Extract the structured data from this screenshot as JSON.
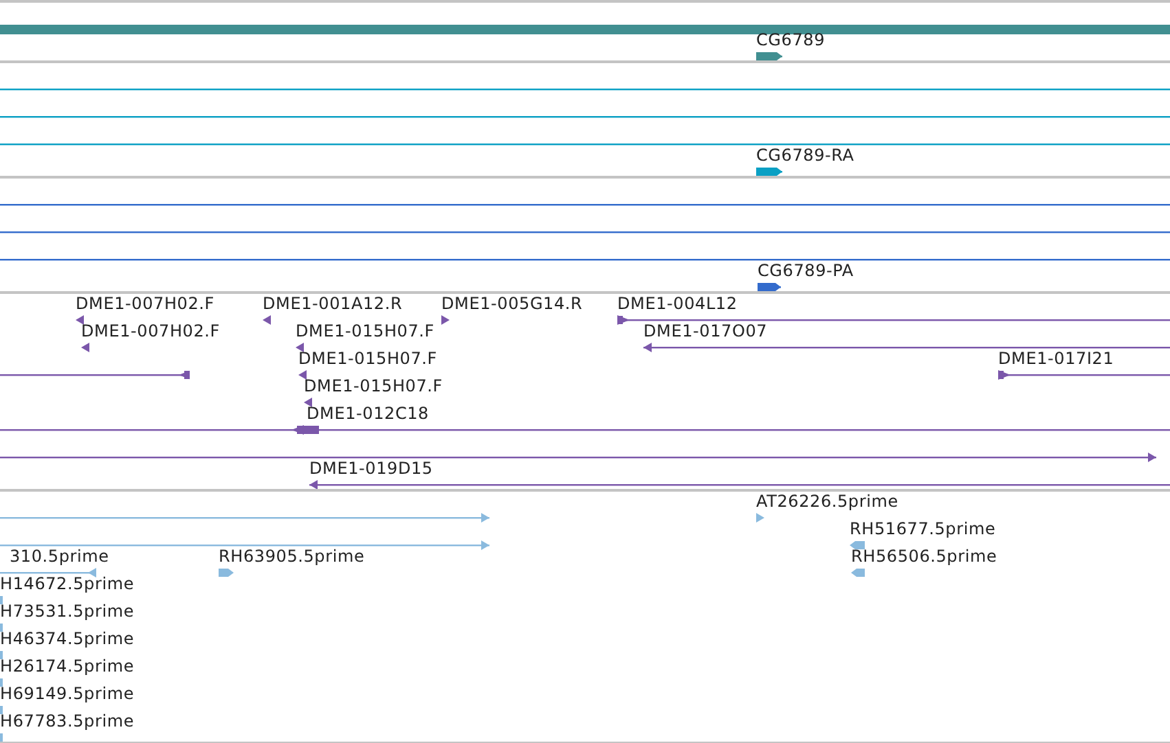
{
  "tracks": [
    {
      "color": "#418f91",
      "features": [
        {
          "kind": "span"
        },
        {
          "kind": "feature",
          "label": "CG6789",
          "reverse": false
        }
      ]
    },
    {
      "color": "#0aa0c4",
      "features": [
        {
          "kind": "span"
        },
        {
          "kind": "span"
        },
        {
          "kind": "span"
        },
        {
          "kind": "feature",
          "label": "CG6789-RA",
          "reverse": false
        }
      ]
    },
    {
      "color": "#336bcc",
      "features": [
        {
          "kind": "span"
        },
        {
          "kind": "span"
        },
        {
          "kind": "span"
        },
        {
          "kind": "feature",
          "label": "CG6789-PA",
          "reverse": false
        }
      ]
    },
    {
      "color": "#7b57aa",
      "features": [
        {
          "kind": "feature",
          "label": "DME1-007H02.F",
          "reverse": true
        },
        {
          "kind": "feature",
          "label": "DME1-001A12.R",
          "reverse": true
        },
        {
          "kind": "feature",
          "label": "DME1-005G14.R",
          "reverse": false
        },
        {
          "kind": "feature",
          "label": "DME1-004L12",
          "reverse": false
        },
        {
          "kind": "feature",
          "label": "DME1-007H02.F",
          "reverse": true
        },
        {
          "kind": "feature",
          "label": "DME1-015H07.F",
          "reverse": true
        },
        {
          "kind": "feature",
          "label": "DME1-017O07",
          "reverse": true
        },
        {
          "kind": "feature",
          "reverse": true
        },
        {
          "kind": "feature",
          "label": "DME1-015H07.F",
          "reverse": true
        },
        {
          "kind": "feature",
          "label": "DME1-017I21",
          "reverse": false
        },
        {
          "kind": "feature",
          "label": "DME1-015H07.F",
          "reverse": true
        },
        {
          "kind": "feature",
          "label": "DME1-012C18",
          "reverse": true
        },
        {
          "kind": "feature",
          "reverse": false
        },
        {
          "kind": "feature",
          "label": "DME1-019D15",
          "reverse": true
        }
      ]
    },
    {
      "color": "#8abade",
      "features": [
        {
          "kind": "feature",
          "reverse": false
        },
        {
          "kind": "feature",
          "label": "AT26226.5prime",
          "reverse": false
        },
        {
          "kind": "feature",
          "reverse": false
        },
        {
          "kind": "feature",
          "label": "RH51677.5prime",
          "reverse": true
        },
        {
          "kind": "feature",
          "label": "310.5prime",
          "reverse": true
        },
        {
          "kind": "feature",
          "label": "RH63905.5prime",
          "reverse": false
        },
        {
          "kind": "feature",
          "label": "RH56506.5prime",
          "reverse": true
        },
        {
          "kind": "block",
          "label": "H14672.5prime"
        },
        {
          "kind": "block",
          "label": "H73531.5prime"
        },
        {
          "kind": "block",
          "label": "H46374.5prime"
        },
        {
          "kind": "block",
          "label": "H26174.5prime"
        },
        {
          "kind": "block",
          "label": "H69149.5prime"
        },
        {
          "kind": "block",
          "label": "H67783.5prime"
        }
      ]
    }
  ]
}
